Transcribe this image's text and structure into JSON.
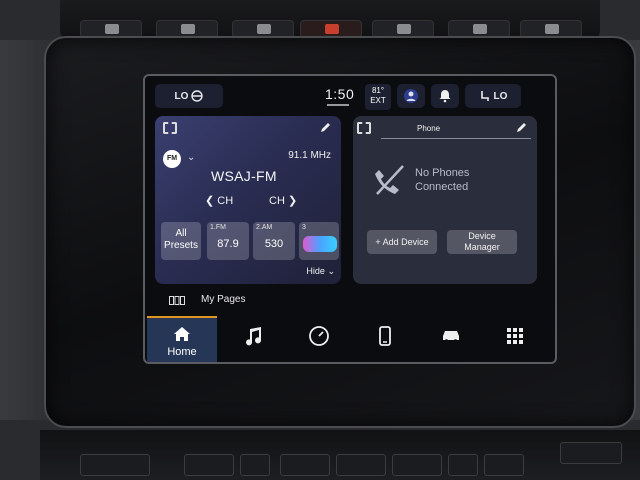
{
  "status_bar": {
    "left_pill": "LO",
    "time": "1:50",
    "temperature": "81°",
    "temperature_label": "EXT",
    "right_pill": "LO"
  },
  "radio": {
    "band": "FM",
    "frequency": "91.1 MHz",
    "station": "WSAJ-FM",
    "ch_prev": "CH",
    "ch_next": "CH",
    "all_presets": "All Presets",
    "presets": [
      {
        "num": "1.FM",
        "value": "87.9"
      },
      {
        "num": "2.AM",
        "value": "530"
      },
      {
        "num": "3",
        "value": ""
      }
    ],
    "hide": "Hide"
  },
  "phone": {
    "title": "Phone",
    "status_line1": "No Phones",
    "status_line2": "Connected",
    "add_device": "+ Add Device",
    "device_manager": "Device Manager"
  },
  "my_pages": "My Pages",
  "nav": {
    "home": "Home"
  },
  "colors": {
    "accent": "#e09420",
    "home_bg": "#253656",
    "radio_card": "#3a3f70",
    "phone_card": "#2a2d3c"
  }
}
